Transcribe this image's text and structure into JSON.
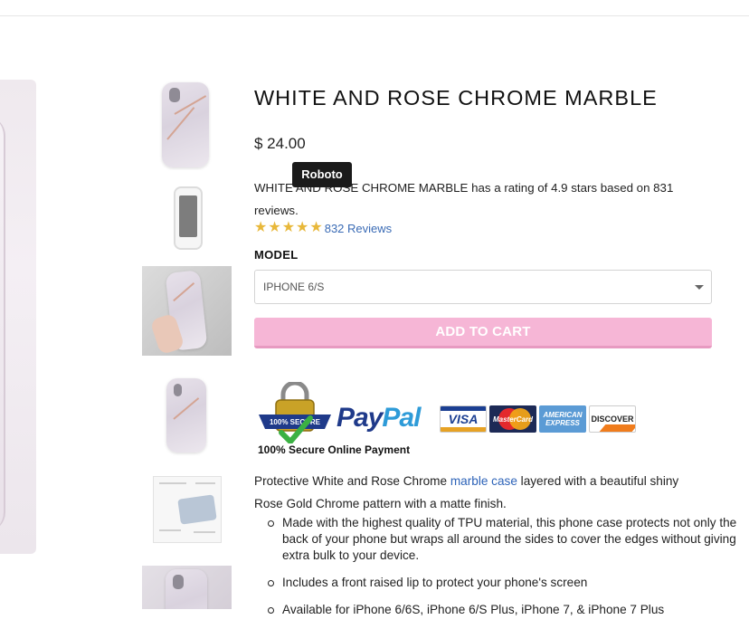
{
  "product": {
    "title": "WHITE AND ROSE CHROME MARBLE",
    "price": "$ 24.00",
    "rating_text": "WHITE AND ROSE CHROME MARBLE has a rating of 4.9 stars based on 831 reviews.",
    "rating_stars": 5,
    "reviews_link": "832 Reviews"
  },
  "tooltip": {
    "text": "Roboto"
  },
  "model": {
    "label": "MODEL",
    "selected": "IPHONE 6/S"
  },
  "cart": {
    "add_label": "ADD TO CART"
  },
  "payment": {
    "seal_text": "100% SECURE",
    "paypal_pay": "Pay",
    "paypal_pal": "Pal",
    "cards": [
      "VISA",
      "MasterCard",
      "AMERICAN EXPRESS",
      "DISCOVER"
    ],
    "caption": "100% Secure Online Payment"
  },
  "description": {
    "intro_before": "Protective White and Rose Chrome ",
    "intro_link": "marble case",
    "intro_after": " layered with a beautiful shiny Rose Gold Chrome pattern with a matte finish.",
    "bullets": [
      "Made with the highest quality of TPU material, this phone case protects not only the back of your phone but wraps all around the sides to cover the edges without giving extra bulk to your device.",
      "Includes a front raised lip to protect your phone's screen",
      "Available for iPhone 6/6S, iPhone 6/S Plus, iPhone 7, & iPhone 7 Plus"
    ]
  },
  "colors": {
    "accent_button": "#f6b6d6",
    "star": "#e8b83a",
    "link": "#3a6bb5"
  },
  "icons": [
    "star-icon",
    "dropdown-caret-icon",
    "secure-lock-seal-icon",
    "paypal-logo",
    "visa-card-icon",
    "mastercard-icon",
    "amex-card-icon",
    "discover-card-icon"
  ]
}
